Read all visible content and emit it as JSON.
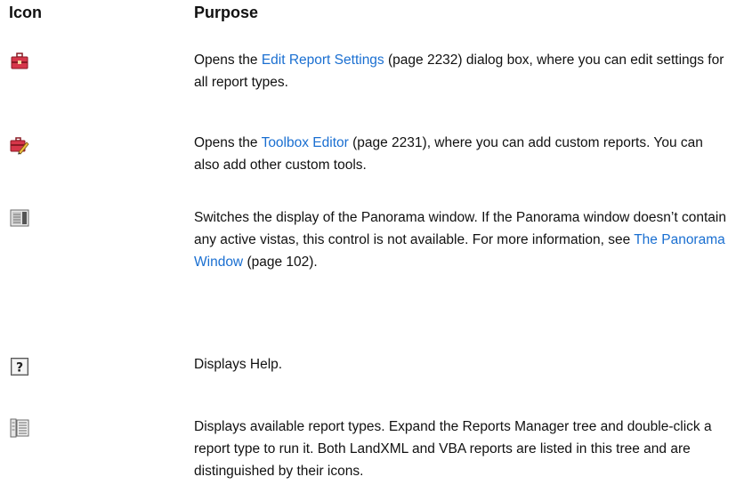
{
  "header": {
    "icon": "Icon",
    "purpose": "Purpose"
  },
  "rows": [
    {
      "icon": "toolbox-icon",
      "pre": "Opens the ",
      "link": "Edit Report Settings",
      "post": " (page 2232) dialog box, where you can edit settings for all report types."
    },
    {
      "icon": "toolbox-edit-icon",
      "pre": "Opens the ",
      "link": "Toolbox Editor",
      "post": " (page 2231), where you can add custom reports. You can also add other custom tools."
    },
    {
      "icon": "panorama-icon",
      "pre": "Switches the display of the Panorama window. If the Panorama window doesn’t contain any active vistas, this control is not available. For more information, see ",
      "link": "The Panorama Window",
      "post": " (page 102)."
    },
    {
      "icon": "help-icon",
      "text": "Displays Help."
    },
    {
      "icon": "report-tree-icon",
      "text": "Displays available report types. Expand the Reports Manager tree and double-click a report type to run it. Both LandXML and VBA reports are listed in this tree and are distinguished by their icons."
    }
  ],
  "colors": {
    "link": "#1a6fd1",
    "toolbox_red": "#c8283a"
  }
}
